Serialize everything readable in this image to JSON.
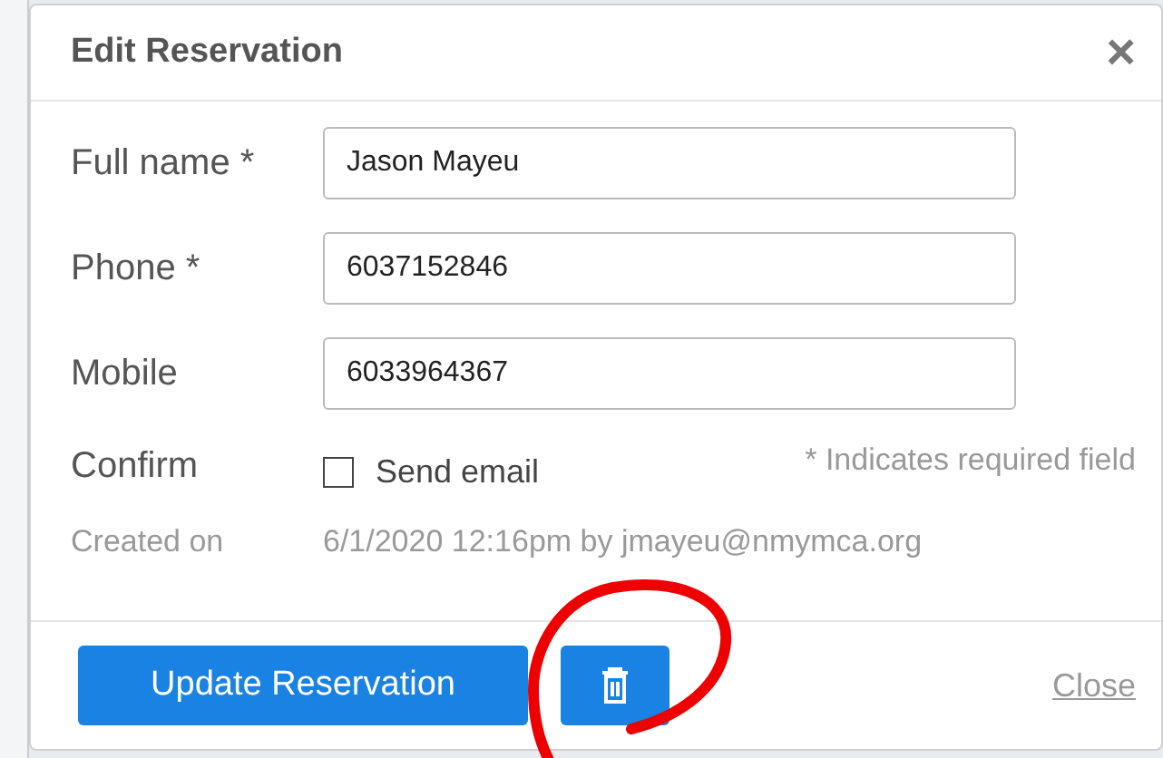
{
  "dialog": {
    "title": "Edit Reservation",
    "close_icon": "×"
  },
  "fields": [
    {
      "label": "Full name *",
      "value": "Jason Mayeu"
    },
    {
      "label": "Phone *",
      "value": "6037152846"
    },
    {
      "label": "Mobile",
      "value": "6033964367"
    }
  ],
  "confirm": {
    "label": "Confirm",
    "option": "Send email",
    "checked": false,
    "note": "* Indicates required field"
  },
  "created": {
    "label": "Created on",
    "value": "6/1/2020 12:16pm by jmayeu@nmymca.org"
  },
  "footer": {
    "primary": "Update Reservation",
    "close": "Close"
  }
}
